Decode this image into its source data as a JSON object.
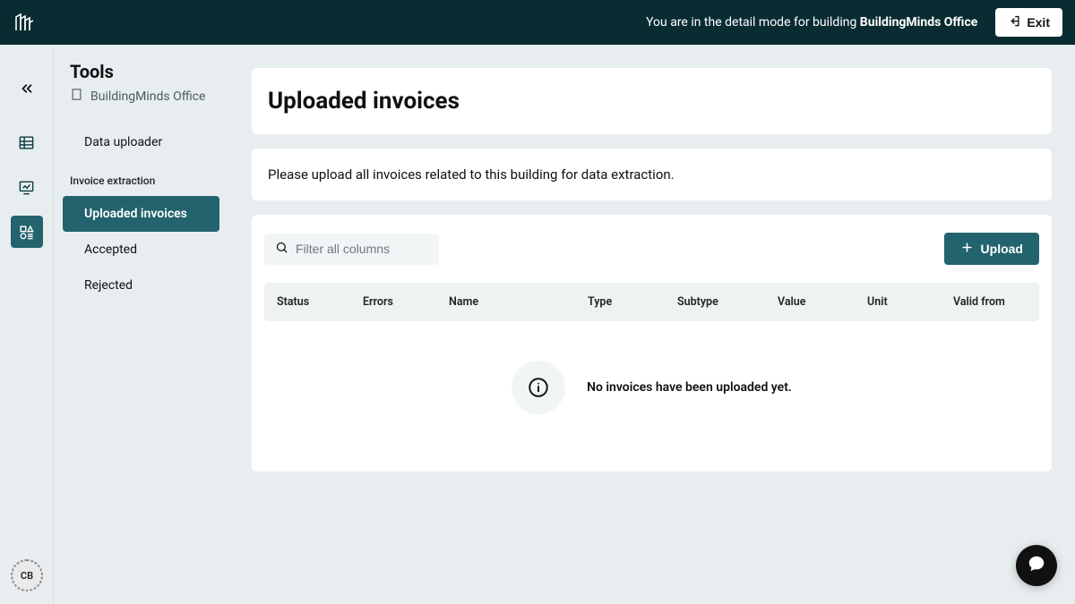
{
  "header": {
    "detail_mode_prefix": "You are in the detail mode for building ",
    "detail_mode_building": "BuildingMinds Office",
    "exit_label": "Exit"
  },
  "avatar": {
    "initials": "CB"
  },
  "sidebar": {
    "title": "Tools",
    "building_name": "BuildingMinds Office",
    "data_uploader_label": "Data uploader",
    "section_label": "Invoice extraction",
    "items": {
      "uploaded": "Uploaded invoices",
      "accepted": "Accepted",
      "rejected": "Rejected"
    }
  },
  "main": {
    "page_title": "Uploaded invoices",
    "instruction": "Please upload all invoices related to this building for data extraction.",
    "filter_placeholder": "Filter all columns",
    "upload_label": "Upload",
    "columns": {
      "status": "Status",
      "errors": "Errors",
      "name": "Name",
      "type": "Type",
      "subtype": "Subtype",
      "value": "Value",
      "unit": "Unit",
      "valid_from": "Valid from"
    },
    "empty_message": "No invoices have been uploaded yet."
  }
}
